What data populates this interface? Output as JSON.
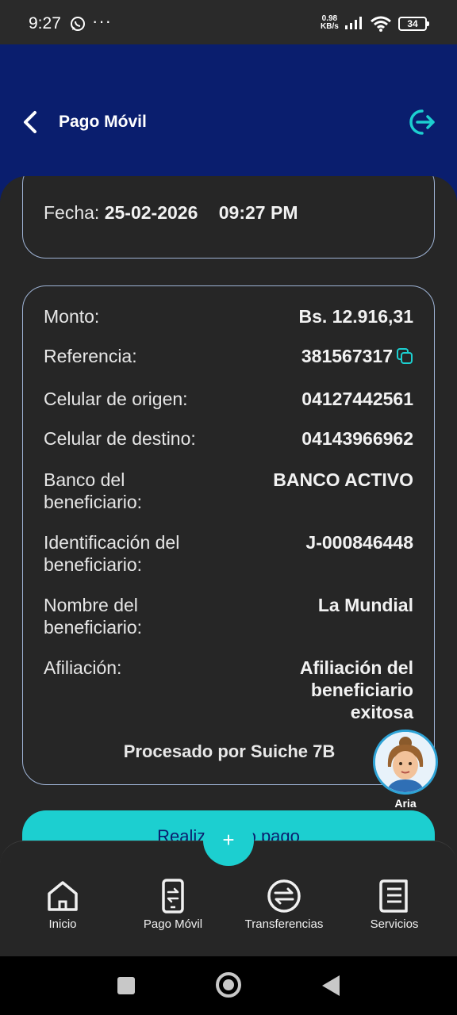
{
  "status_bar": {
    "time": "9:27",
    "dots": "···",
    "speed_value": "0.98",
    "speed_unit": "KB/s",
    "battery": "34"
  },
  "header": {
    "title": "Pago Móvil",
    "back_icon": "chevron-left-icon",
    "logout_icon": "logout-icon",
    "background": "#0a1e6e"
  },
  "date_card": {
    "label": "Fecha:",
    "date": "25-02-2026",
    "time": "09:27 PM"
  },
  "details": {
    "rows": [
      {
        "label": "Monto:",
        "value": "Bs. 12.916,31"
      },
      {
        "label": "Referencia:",
        "value": "381567317"
      },
      {
        "label": "Celular de origen:",
        "value": "04127442561"
      },
      {
        "label": "Celular de destino:",
        "value": "04143966962"
      },
      {
        "label": "Banco del beneficiario:",
        "value": "BANCO ACTIVO"
      },
      {
        "label": "Identificación del beneficiario:",
        "value": "J-000846448"
      },
      {
        "label": "Nombre del beneficiario:",
        "value": "La Mundial"
      },
      {
        "label": "Afiliación:",
        "value": "Afiliación del beneficiario exitosa"
      }
    ],
    "processed_by": "Procesado por Suiche 7B"
  },
  "assistant": {
    "name": "Aria"
  },
  "action_button": {
    "label": "Realizar otro pago"
  },
  "fab": {
    "label": "+"
  },
  "bottom_nav": [
    {
      "label": "Inicio",
      "icon": "home-icon"
    },
    {
      "label": "Pago Móvil",
      "icon": "phone-transfer-icon"
    },
    {
      "label": "Transferencias",
      "icon": "transfer-icon"
    },
    {
      "label": "Servicios",
      "icon": "receipt-icon"
    }
  ],
  "colors": {
    "accent": "#1ccfd0",
    "card_border": "#9fb4d6",
    "sheet": "#262626"
  }
}
